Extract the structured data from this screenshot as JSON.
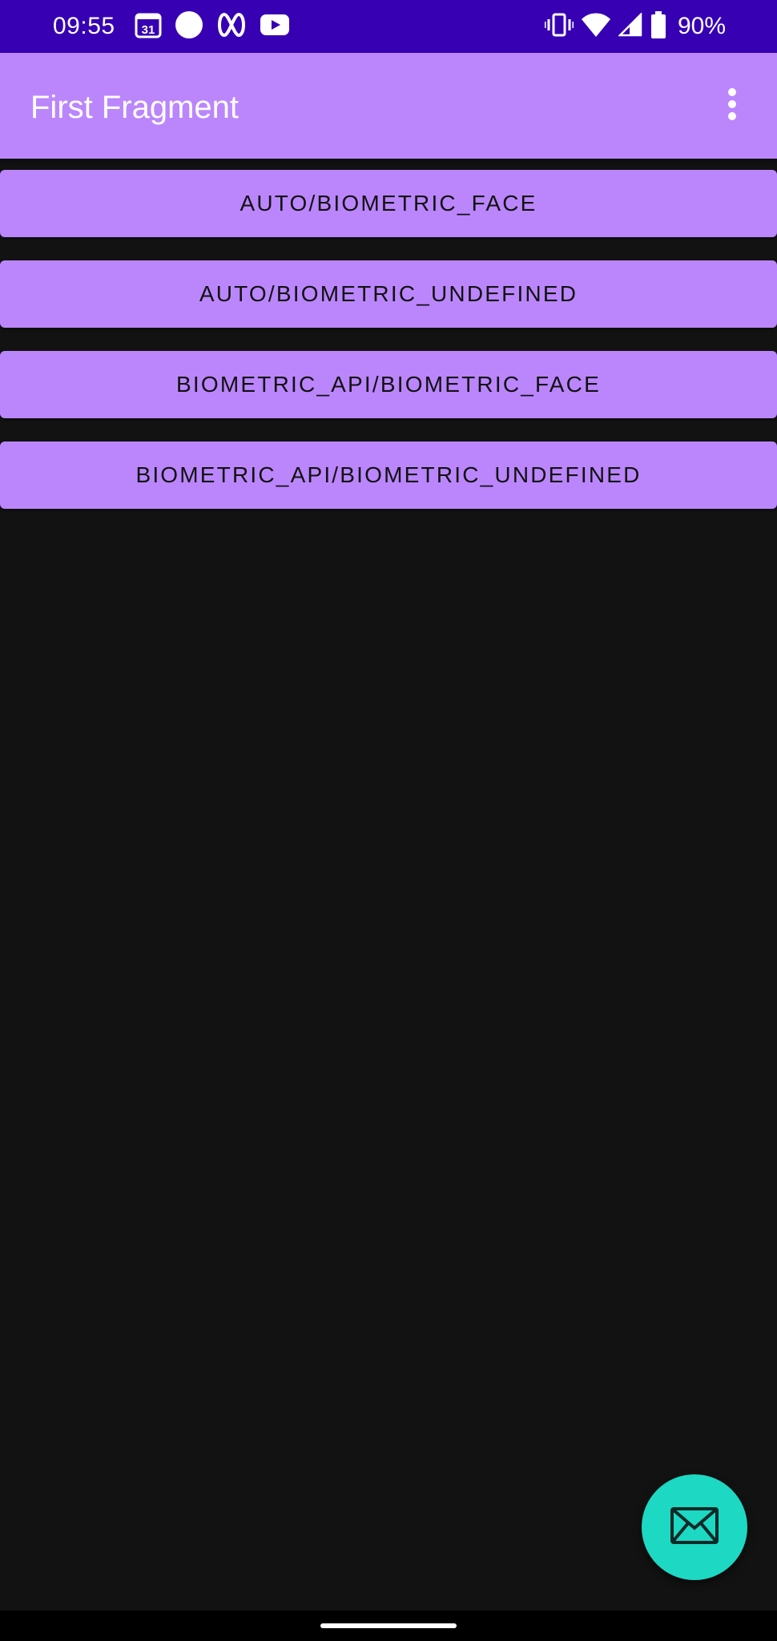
{
  "status_bar": {
    "time": "09:55",
    "battery": "90%",
    "calendar_day": "31",
    "left_icons": [
      "calendar-icon",
      "circle-icon",
      "infinity-loop-icon",
      "youtube-icon"
    ],
    "right_icons": [
      "vibrate-icon",
      "wifi-icon",
      "cell-signal-icon",
      "battery-icon"
    ]
  },
  "app_bar": {
    "title": "First Fragment",
    "overflow_icon": "more-vertical-icon"
  },
  "buttons": [
    {
      "label": "AUTO/BIOMETRIC_FACE"
    },
    {
      "label": "AUTO/BIOMETRIC_UNDEFINED"
    },
    {
      "label": "BIOMETRIC_API/BIOMETRIC_FACE"
    },
    {
      "label": "BIOMETRIC_API/BIOMETRIC_UNDEFINED"
    }
  ],
  "fab": {
    "icon": "mail-icon"
  },
  "colors": {
    "status_bar": "#3700B3",
    "primary": "#BB86FC",
    "background": "#121212",
    "fab": "#1DD8C3"
  }
}
